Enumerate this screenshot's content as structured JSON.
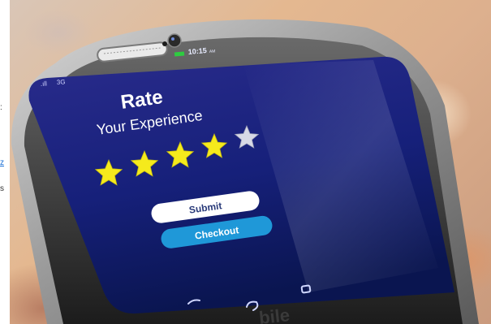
{
  "status_bar": {
    "time": "10:15",
    "ampm": "AM",
    "signal_label": "3G"
  },
  "rating": {
    "title": "Rate",
    "subtitle": "Your Experience",
    "stars_filled": 4,
    "stars_total": 5
  },
  "buttons": {
    "submit_label": "Submit",
    "checkout_label": "Checkout"
  },
  "phone": {
    "back_text": "bile"
  },
  "colors": {
    "screen_top": "#2a2c8c",
    "screen_bottom": "#0a1550",
    "star_filled": "#f5ea1c",
    "star_empty": "#d7d9e6",
    "submit_bg": "#ffffff",
    "checkout_bg": "#1f98d8",
    "battery": "#2ecc40"
  },
  "left_edge_fragments": [
    ":",
    "z",
    "s"
  ]
}
